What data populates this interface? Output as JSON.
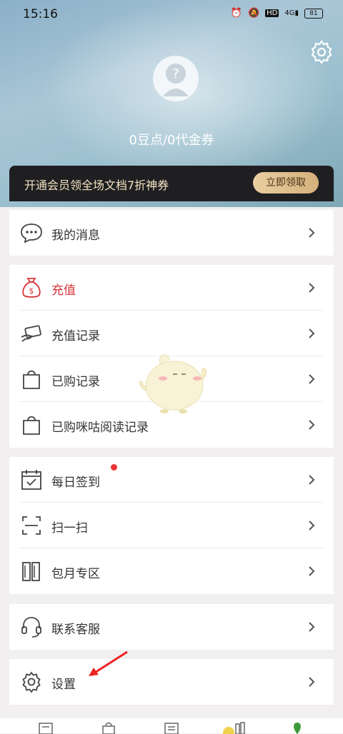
{
  "status_bar": {
    "time": "15:16",
    "battery": "81",
    "network": "4G",
    "hd": "HD"
  },
  "profile": {
    "balance_text": "0豆点/0代金券"
  },
  "vip_banner": {
    "text": "开通会员领全场文档7折神券",
    "button": "立即领取"
  },
  "menu": {
    "messages": "我的消息",
    "recharge": "充值",
    "recharge_history": "充值记录",
    "purchased": "已购记录",
    "purchased_migu": "已购咪咕阅读记录",
    "daily_signin": "每日签到",
    "scan": "扫一扫",
    "monthly": "包月专区",
    "customer_service": "联系客服",
    "settings": "设置"
  },
  "colors": {
    "accent_red": "#d9343a",
    "gold": "#d4b07a"
  },
  "icons": [
    "settings-gear-icon",
    "chat-bubble-icon",
    "money-bag-icon",
    "card-hand-icon",
    "shopping-bag-icon",
    "calendar-check-icon",
    "scan-icon",
    "books-icon",
    "headset-icon",
    "gear-icon",
    "chevron-right-icon"
  ]
}
